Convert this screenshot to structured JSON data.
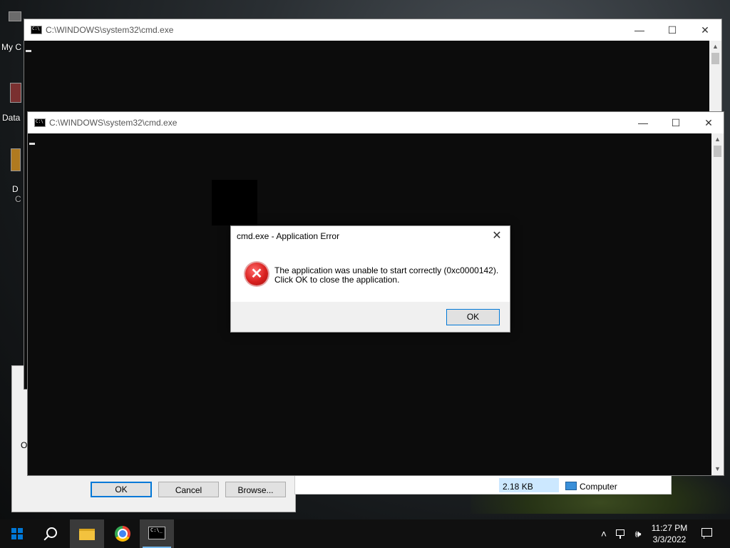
{
  "desktop": {
    "icon_labels": [
      "My C",
      "Data",
      "D",
      "C"
    ]
  },
  "background_dialog": {
    "fragment_label": "O",
    "ok_label": "OK",
    "cancel_label": "Cancel",
    "browse_label": "Browse..."
  },
  "explorer_row": {
    "size": "2.18 KB",
    "location": "Computer"
  },
  "cmd_window_back": {
    "title": "C:\\WINDOWS\\system32\\cmd.exe"
  },
  "cmd_window_front": {
    "title": "C:\\WINDOWS\\system32\\cmd.exe"
  },
  "window_controls": {
    "minimize": "—",
    "maximize": "☐",
    "close": "✕"
  },
  "error_dialog": {
    "title": "cmd.exe - Application Error",
    "message_line1": "The application was unable to start correctly (0xc0000142).",
    "message_line2": "Click OK to close the application.",
    "ok_label": "OK",
    "icon": "error-icon"
  },
  "taskbar": {
    "items": [
      "start",
      "search",
      "file-explorer",
      "chrome",
      "command-prompt"
    ],
    "time": "11:27 PM",
    "date": "3/3/2022"
  },
  "colors": {
    "accent": "#0078d7",
    "error_red": "#d9211f",
    "console_bg": "#0c0c0c",
    "taskbar_bg": "#101010"
  }
}
